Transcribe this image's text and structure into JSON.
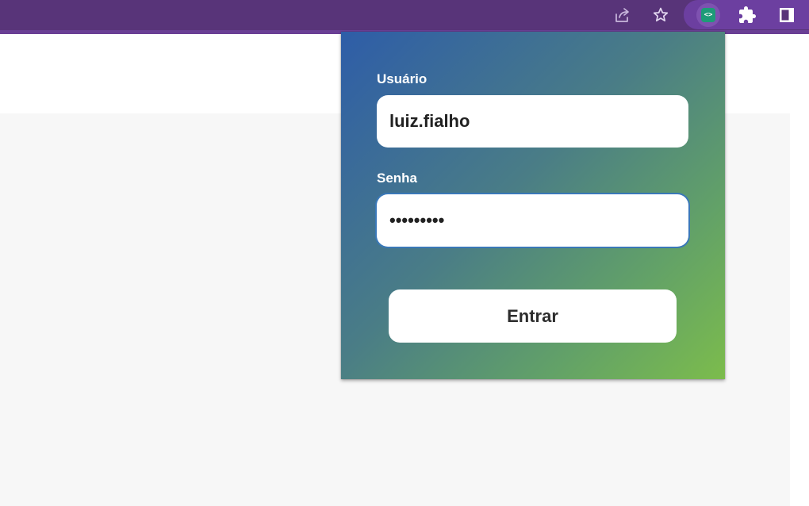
{
  "browser": {
    "toolbar_color": "#583479",
    "icons": {
      "share": "share-icon",
      "bookmark": "star-icon",
      "extension_active": "code-extension-icon",
      "extensions": "puzzle-icon",
      "side_panel": "side-panel-icon"
    },
    "extension_badge_text": "<>"
  },
  "login_popup": {
    "gradient": [
      "#2e5da8",
      "#7cbc4c"
    ],
    "username": {
      "label": "Usuário",
      "value": "luiz.fialho"
    },
    "password": {
      "label": "Senha",
      "value": "passwords"
    },
    "submit_label": "Entrar"
  }
}
